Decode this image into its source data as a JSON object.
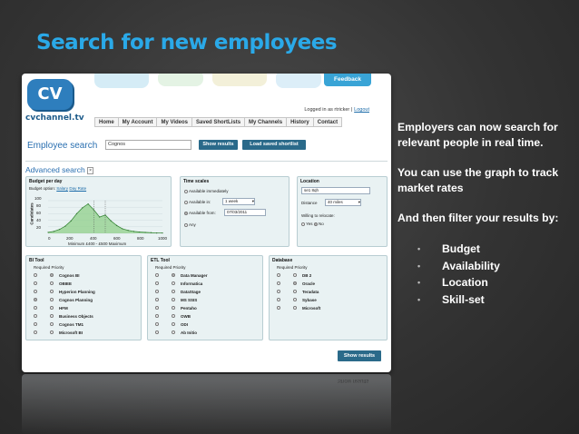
{
  "slide": {
    "title": "Search for new employees",
    "paragraphs": [
      "Employers can now search for relevant people in real time.",
      "You can use the graph to track market rates",
      "And then filter your results by:"
    ],
    "bullets": [
      "Budget",
      "Availability",
      "Location",
      "Skill-set"
    ]
  },
  "site": {
    "feedback_label": "Feedback",
    "logo_text": "CV",
    "logo_domain": "cvchannel.tv",
    "logged_in_text": "Logged in as rtricker |",
    "logout_label": "Logout",
    "nav": [
      "Home",
      "My Account",
      "My Videos",
      "Saved ShortLists",
      "My Channels",
      "History",
      "Contact"
    ],
    "employee_search_title": "Employee search",
    "search_value": "Cognos",
    "show_results_label": "Show results",
    "load_shortlist_label": "Load saved shortlist",
    "advanced_search_title": "Advanced search",
    "bottom_show_results_label": "Show results"
  },
  "budget": {
    "title": "Budget per day",
    "option_label": "Budget option:",
    "options": [
      "Salary",
      "Day Rate"
    ],
    "y_axis_label": "Candidates",
    "y_ticks": [
      "100",
      "80",
      "60",
      "40",
      "20"
    ],
    "x_ticks": [
      "0",
      "200",
      "400",
      "600",
      "800",
      "1000"
    ],
    "range_text": "Minimum £400 - £500 Maximum"
  },
  "chart_data": {
    "type": "area",
    "x": [
      0,
      50,
      100,
      150,
      200,
      250,
      300,
      350,
      400,
      450,
      500,
      550,
      600,
      650,
      700,
      750,
      800,
      850,
      900,
      950,
      1000
    ],
    "values": [
      3,
      6,
      12,
      22,
      38,
      60,
      78,
      90,
      72,
      50,
      56,
      38,
      24,
      14,
      9,
      6,
      4,
      3,
      2,
      1,
      1
    ],
    "xlim": [
      0,
      1000
    ],
    "ylim": [
      0,
      100
    ],
    "xlabel": "",
    "ylabel": "Candidates"
  },
  "time": {
    "title": "Time scales",
    "opt1": "Available immediately",
    "opt2": "Available in:",
    "opt2_value": "1 week",
    "opt3": "Available from:",
    "opt3_value": "07/03/2011",
    "opt4": "Any"
  },
  "location": {
    "title": "Location",
    "postcode": "se1 8qh",
    "distance_label": "Distance",
    "distance_value": "40 miles",
    "relocate_label": "Willing to relocate:",
    "yes": "Yes",
    "no": "No"
  },
  "bi": {
    "title": "BI Tool",
    "headers": [
      "Required",
      "Priority"
    ],
    "items": [
      "Cognos BI",
      "OBIEE",
      "Hyperion Planning",
      "Cognos Planning",
      "HFM",
      "Business Objects",
      "Cognos TM1",
      "Microsoft BI"
    ]
  },
  "etl": {
    "title": "ETL Tool",
    "headers": [
      "Required",
      "Priority"
    ],
    "items": [
      "Data Manager",
      "Informatica",
      "DataStage",
      "MS SSIS",
      "Pentaho",
      "OWB",
      "ODI",
      "Ab Initio"
    ]
  },
  "db": {
    "title": "Database",
    "headers": [
      "Required",
      "Priority"
    ],
    "items": [
      "DB 2",
      "Oracle",
      "Teradata",
      "Sybase",
      "Microsoft"
    ]
  }
}
